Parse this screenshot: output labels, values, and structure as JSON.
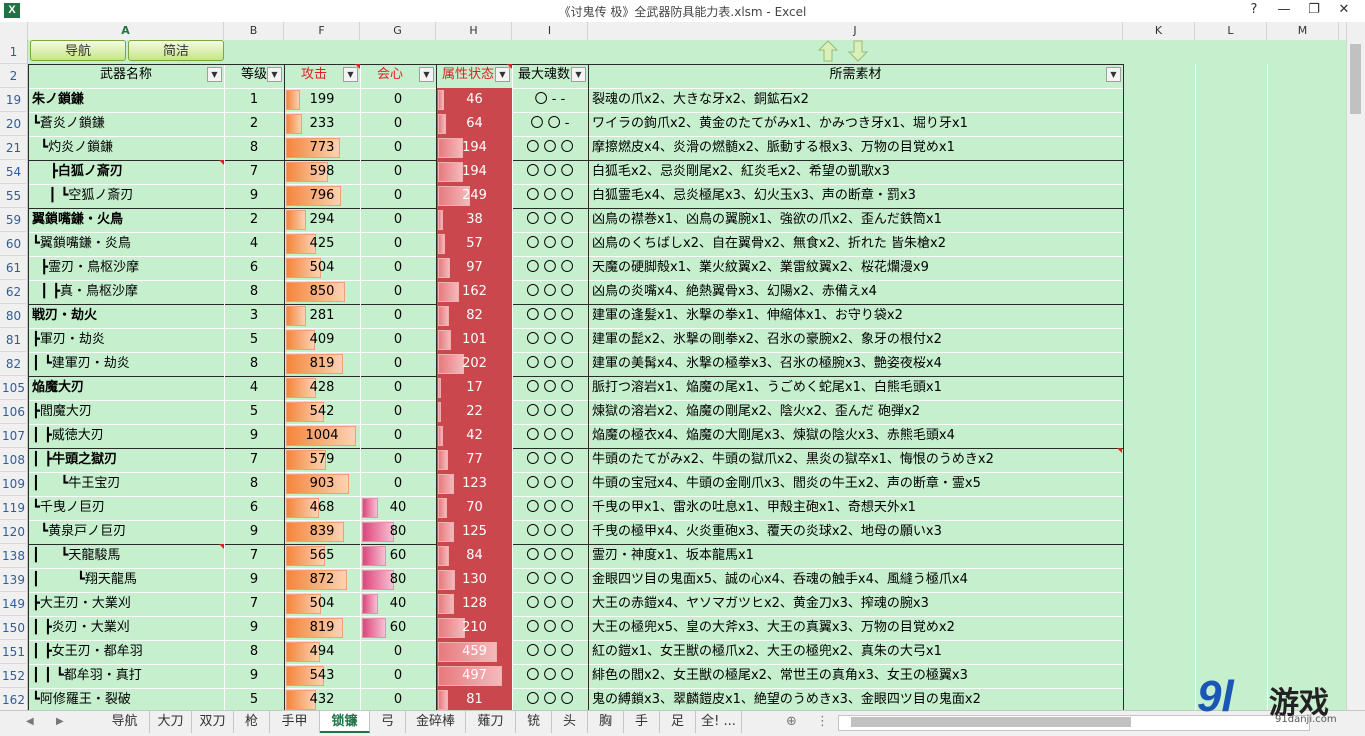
{
  "window": {
    "title": "《讨鬼传 极》全武器防具能力表.xlsm - Excel",
    "app_icon": "X",
    "buttons": [
      "?",
      "—",
      "❐",
      "✕"
    ]
  },
  "columns": [
    "A",
    "B",
    "F",
    "G",
    "H",
    "I",
    "J",
    "K",
    "L",
    "M"
  ],
  "row1": {
    "nav_label": "导航",
    "simple_label": "简洁"
  },
  "headers": {
    "name": "武器名称",
    "level": "等级",
    "attack": "攻击",
    "crit": "会心",
    "element": "属性状态",
    "soul": "最大魂数",
    "materials": "所需素材"
  },
  "rows": [
    {
      "rn": "19",
      "name": "朱ノ鎖鎌",
      "bold": true,
      "lvl": "1",
      "atk": "199",
      "crit": "0",
      "elem": "46",
      "soul": "〇 - -",
      "mat": "裂魂の爪x2、大きな牙x2、銅鉱石x2"
    },
    {
      "rn": "20",
      "name": "┗蒼炎ノ鎖鎌",
      "bold": false,
      "lvl": "2",
      "atk": "233",
      "crit": "0",
      "elem": "64",
      "soul": "〇 〇 -",
      "mat": "ワイラの鉤爪x2、黄金のたてがみx1、かみつき牙x1、堀り牙x1"
    },
    {
      "rn": "21",
      "name": "  ┗灼炎ノ鎖鎌",
      "bold": false,
      "lvl": "8",
      "atk": "773",
      "crit": "0",
      "elem": "194",
      "soul": "〇 〇 〇",
      "mat": "摩擦燃皮x4、炎滑の燃髄x2、脈動する根x3、万物の目覚めx1"
    },
    {
      "rn": "54",
      "name": "    ┣白狐ノ斎刃",
      "bold": true,
      "lvl": "7",
      "atk": "598",
      "crit": "0",
      "elem": "194",
      "soul": "〇 〇 〇",
      "mat": "白狐毛x2、忌炎剛尾x2、紅炎毛x2、希望の凱歌x3"
    },
    {
      "rn": "55",
      "name": "    ┃ ┗空狐ノ斎刃",
      "bold": false,
      "lvl": "9",
      "atk": "796",
      "crit": "0",
      "elem": "249",
      "soul": "〇 〇 〇",
      "mat": "白狐霊毛x4、忌炎極尾x3、幻火玉x3、声の断章・罰x3"
    },
    {
      "rn": "59",
      "name": "翼鎖嘴鎌・火鳥",
      "bold": true,
      "lvl": "2",
      "atk": "294",
      "crit": "0",
      "elem": "38",
      "soul": "〇 〇 〇",
      "mat": "凶鳥の襟巻x1、凶鳥の翼腕x1、強欲の爪x2、歪んだ鉄筒x1"
    },
    {
      "rn": "60",
      "name": "┗翼鎖嘴鎌・炎鳥",
      "bold": false,
      "lvl": "4",
      "atk": "425",
      "crit": "0",
      "elem": "57",
      "soul": "〇 〇 〇",
      "mat": "凶鳥のくちばしx2、自在翼骨x2、無食x2、折れた 皆朱槍x2"
    },
    {
      "rn": "61",
      "name": "  ┣霊刃・鳥枢沙摩",
      "bold": false,
      "lvl": "6",
      "atk": "504",
      "crit": "0",
      "elem": "97",
      "soul": "〇 〇 〇",
      "mat": "天魔の硬脚殻x1、業火紋翼x2、業雷紋翼x2、桜花爛漫x9"
    },
    {
      "rn": "62",
      "name": "  ┃ ┣真・鳥枢沙摩",
      "bold": false,
      "lvl": "8",
      "atk": "850",
      "crit": "0",
      "elem": "162",
      "soul": "〇 〇 〇",
      "mat": "凶鳥の炎嘴x4、絶熱翼骨x3、幻陽x2、赤備えx4"
    },
    {
      "rn": "80",
      "name": "戦刃・劫火",
      "bold": true,
      "lvl": "3",
      "atk": "281",
      "crit": "0",
      "elem": "82",
      "soul": "〇 〇 〇",
      "mat": "建軍の逢髪x1、氷撃の拳x1、伸縮体x1、お守り袋x2"
    },
    {
      "rn": "81",
      "name": "┣軍刃・劫炎",
      "bold": false,
      "lvl": "5",
      "atk": "409",
      "crit": "0",
      "elem": "101",
      "soul": "〇 〇 〇",
      "mat": "建軍の髭x2、氷撃の剛拳x2、召氷の豪腕x2、象牙の根付x2"
    },
    {
      "rn": "82",
      "name": "┃ ┗建軍刃・劫炎",
      "bold": false,
      "lvl": "8",
      "atk": "819",
      "crit": "0",
      "elem": "202",
      "soul": "〇 〇 〇",
      "mat": "建軍の美髯x4、氷撃の極拳x3、召氷の極腕x3、艶姿夜桜x4"
    },
    {
      "rn": "105",
      "name": "焔魔大刃",
      "bold": true,
      "lvl": "4",
      "atk": "428",
      "crit": "0",
      "elem": "17",
      "soul": "〇 〇 〇",
      "mat": "脈打つ溶岩x1、焔魔の尾x1、うごめく蛇尾x1、白熊毛頭x1"
    },
    {
      "rn": "106",
      "name": "┣閻魔大刃",
      "bold": false,
      "lvl": "5",
      "atk": "542",
      "crit": "0",
      "elem": "22",
      "soul": "〇 〇 〇",
      "mat": "煉獄の溶岩x2、焔魔の剛尾x2、陰火x2、歪んだ 砲弾x2"
    },
    {
      "rn": "107",
      "name": "┃ ┣威徳大刃",
      "bold": false,
      "lvl": "9",
      "atk": "1004",
      "crit": "0",
      "elem": "42",
      "soul": "〇 〇 〇",
      "mat": "焔魔の極衣x4、焔魔の大剛尾x3、煉獄の陰火x3、赤熊毛頭x4"
    },
    {
      "rn": "108",
      "name": "┃ ┣牛頭之獄刃",
      "bold": true,
      "lvl": "7",
      "atk": "579",
      "crit": "0",
      "elem": "77",
      "soul": "〇 〇 〇",
      "mat": "牛頭のたてがみx2、牛頭の獄爪x2、黒炎の獄卒x1、悔恨のうめきx2"
    },
    {
      "rn": "109",
      "name": "┃     ┗牛王宝刃",
      "bold": false,
      "lvl": "8",
      "atk": "903",
      "crit": "0",
      "elem": "123",
      "soul": "〇 〇 〇",
      "mat": "牛頭の宝冠x4、牛頭の金剛爪x3、閻炎の牛王x2、声の断章・霊x5"
    },
    {
      "rn": "119",
      "name": "┗千曳ノ巨刃",
      "bold": false,
      "lvl": "6",
      "atk": "468",
      "crit": "40",
      "elem": "70",
      "soul": "〇 〇 〇",
      "mat": "千曳の甲x1、雷氷の吐息x1、甲殻主砲x1、奇想天外x1"
    },
    {
      "rn": "120",
      "name": "  ┗黄泉戸ノ巨刃",
      "bold": false,
      "lvl": "9",
      "atk": "839",
      "crit": "80",
      "elem": "125",
      "soul": "〇 〇 〇",
      "mat": "千曳の極甲x4、火炎重砲x3、覆天の炎球x2、地母の願いx3"
    },
    {
      "rn": "138",
      "name": "┃     ┗天龍駿馬",
      "bold": false,
      "lvl": "7",
      "atk": "565",
      "crit": "60",
      "elem": "84",
      "soul": "〇 〇 〇",
      "mat": "霊刃・神度x1、坂本龍馬x1"
    },
    {
      "rn": "139",
      "name": "┃         ┗翔天龍馬",
      "bold": false,
      "lvl": "9",
      "atk": "872",
      "crit": "80",
      "elem": "130",
      "soul": "〇 〇 〇",
      "mat": "金眼四ツ目の鬼面x5、誠の心x4、呑魂の触手x4、風縫う極爪x4"
    },
    {
      "rn": "149",
      "name": "┣大王刃・大業刈",
      "bold": false,
      "lvl": "7",
      "atk": "504",
      "crit": "40",
      "elem": "128",
      "soul": "〇 〇 〇",
      "mat": "大王の赤鎧x4、ヤソマガツヒx2、黄金刀x3、搾魂の腕x3"
    },
    {
      "rn": "150",
      "name": "┃ ┣炎刃・大業刈",
      "bold": false,
      "lvl": "9",
      "atk": "819",
      "crit": "60",
      "elem": "210",
      "soul": "〇 〇 〇",
      "mat": "大王の極兜x5、皇の大斧x3、大王の真翼x3、万物の目覚めx2"
    },
    {
      "rn": "151",
      "name": "┃ ┣女王刃・都牟羽",
      "bold": false,
      "lvl": "8",
      "atk": "494",
      "crit": "0",
      "elem": "459",
      "soul": "〇 〇 〇",
      "mat": "紅の鎧x1、女王獣の極爪x2、大王の極兜x2、真朱の大弓x1"
    },
    {
      "rn": "152",
      "name": "┃ ┃ ┗都牟羽・真打",
      "bold": false,
      "lvl": "9",
      "atk": "543",
      "crit": "0",
      "elem": "497",
      "soul": "〇 〇 〇",
      "mat": "緋色の閻x2、女王獣の極尾x2、常世王の真角x3、女王の極翼x3"
    },
    {
      "rn": "162",
      "name": "┗阿修羅王・裂破",
      "bold": false,
      "lvl": "5",
      "atk": "432",
      "crit": "0",
      "elem": "81",
      "soul": "〇 〇 〇",
      "mat": "鬼の縛鎖x3、翠麟鎧皮x1、絶望のうめきx3、金眼四ツ目の鬼面x2"
    }
  ],
  "sheet_tabs": [
    "导航",
    "大刀",
    "双刀",
    "枪",
    "手甲",
    "锁镰",
    "弓",
    "金碎棒",
    "薙刀",
    "铳",
    "头",
    "胸",
    "手",
    "足",
    "全! ..."
  ],
  "active_tab": "锁镰",
  "watermark": {
    "number": "9l",
    "brand": "游戏",
    "url": "91danji.com"
  }
}
